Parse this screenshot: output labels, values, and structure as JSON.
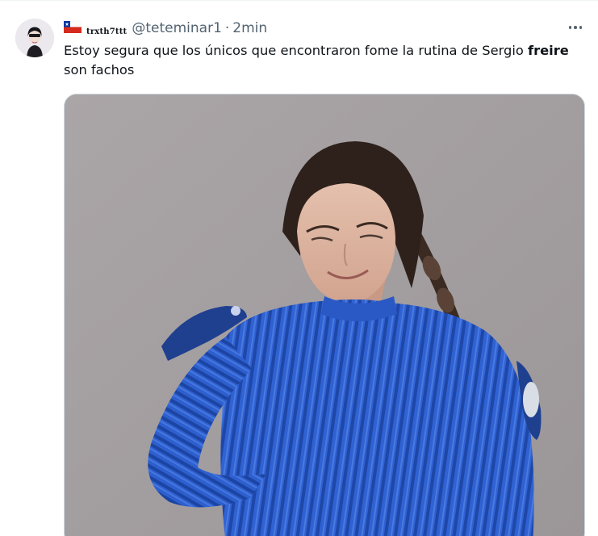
{
  "tweet": {
    "display_name": "trxth7ttt",
    "handle": "@teteminar1",
    "separator": "·",
    "time": "2min",
    "text_before": "Estoy segura que los únicos que encontraron fome la rutina de Sergio ",
    "text_highlight": "freire",
    "text_after": " son fachos",
    "flag_icon": "chile-flag-icon",
    "more_icon": "more-options-icon",
    "media_description": ""
  },
  "colors": {
    "text_primary": "#0f1419",
    "text_secondary": "#536471",
    "border": "#cfd9de",
    "sweater_blue": "#2f62d2",
    "background_gray": "#a49fa1"
  }
}
